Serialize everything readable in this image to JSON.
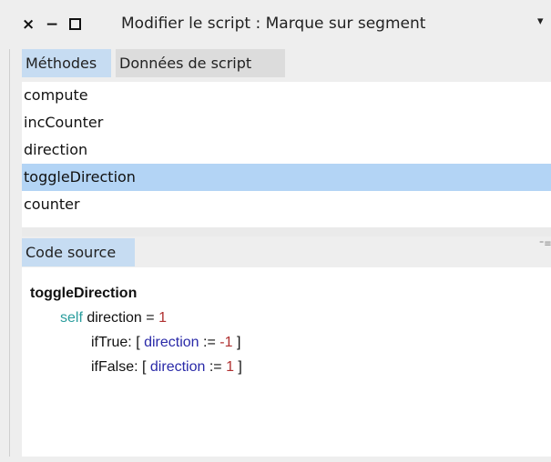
{
  "titlebar": {
    "close_icon": "×",
    "minimize_icon": "−",
    "title": "Modifier le script : Marque sur segment",
    "menu_icon": "▾"
  },
  "tabs_top": [
    {
      "label": "Méthodes",
      "active": true
    },
    {
      "label": "Données de script",
      "active": false
    }
  ],
  "methods": [
    {
      "label": "compute",
      "selected": false
    },
    {
      "label": "incCounter",
      "selected": false
    },
    {
      "label": "direction",
      "selected": false
    },
    {
      "label": "toggleDirection",
      "selected": true
    },
    {
      "label": "counter",
      "selected": false
    }
  ],
  "tabs_bottom": [
    {
      "label": "Code source",
      "active": true
    }
  ],
  "pane_menu_icon": "⁼≡",
  "code": {
    "selector": "toggleDirection",
    "line1": {
      "kw": "self",
      "rest": " direction = ",
      "num": "1"
    },
    "line2": {
      "pre": "ifTrue: [ ",
      "var": "direction",
      "mid": " := ",
      "num": "-1",
      "post": " ]"
    },
    "line3": {
      "pre": "ifFalse: [ ",
      "var": "direction",
      "mid": " := ",
      "num": "1",
      "post": " ]"
    }
  },
  "colors": {
    "selection": "#b3d4f5",
    "active_tab": "#c6dcf2",
    "keyword": "#2a9d9d",
    "variable": "#2a2aa8",
    "number": "#b03030"
  }
}
